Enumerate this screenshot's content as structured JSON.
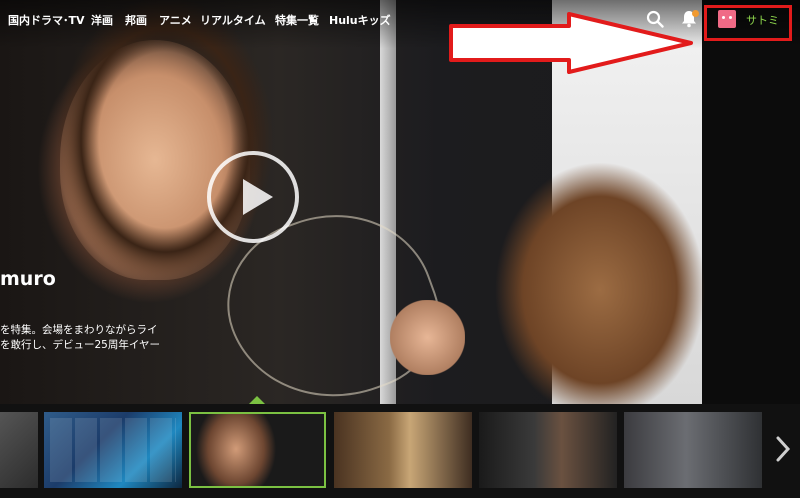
{
  "nav": {
    "items": [
      "国内ドラマ･TV",
      "洋画",
      "邦画",
      "アニメ",
      "リアルタイム",
      "特集一覧",
      "Huluキッズ"
    ]
  },
  "profile": {
    "name": "サトミ"
  },
  "hero": {
    "title": "muro",
    "description_lines": [
      "を特集。会場をまわりながらライ",
      "を敢行し、デビュー25周年イヤー"
    ]
  },
  "colors": {
    "accent_green": "#7bc142",
    "profile_name": "#8bd34b",
    "notification_badge": "#f19a30",
    "annotation_red": "#e21b1b",
    "avatar_pink": "#f06a86"
  },
  "icons": {
    "search": "search-icon",
    "notifications": "bell-icon",
    "play": "play-icon",
    "next": "chevron-right-icon"
  }
}
